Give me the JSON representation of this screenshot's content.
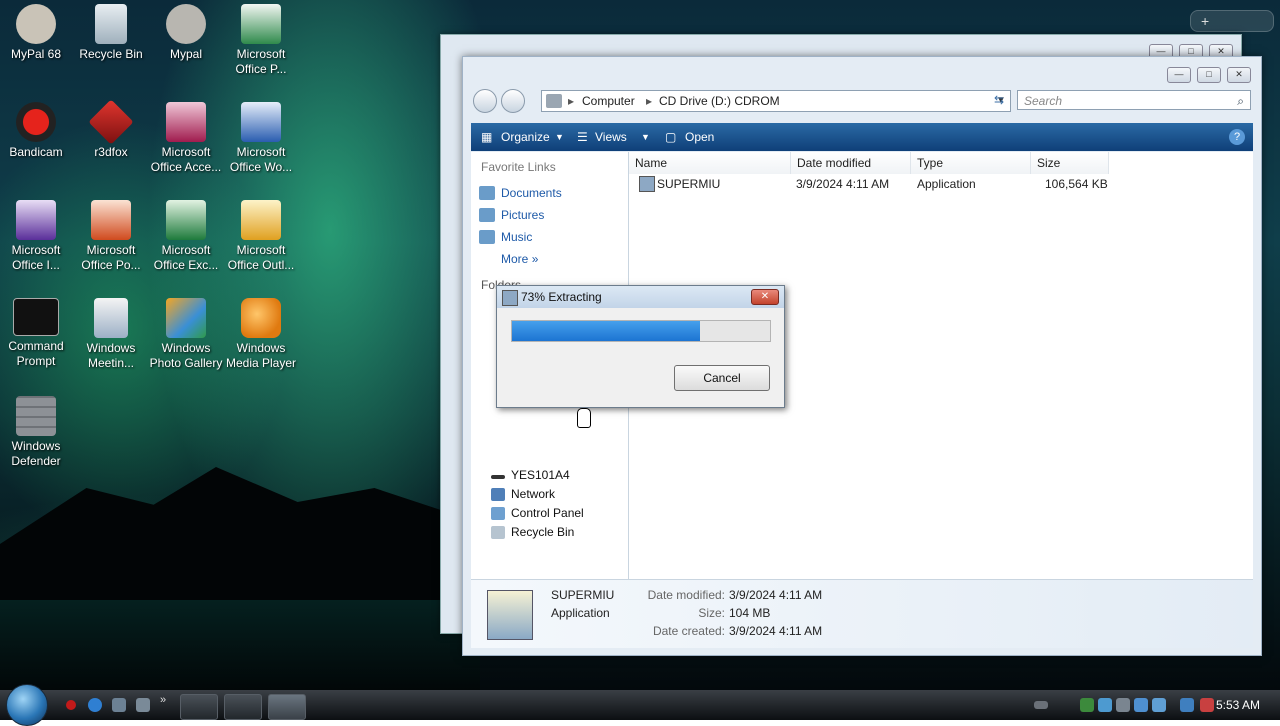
{
  "desktop": {
    "icons": [
      {
        "label": "MyPal 68"
      },
      {
        "label": "Recycle Bin"
      },
      {
        "label": "Mypal"
      },
      {
        "label": "Microsoft Office P..."
      },
      {
        "label": "Bandicam"
      },
      {
        "label": "r3dfox"
      },
      {
        "label": "Microsoft Office Acce..."
      },
      {
        "label": "Microsoft Office Wo..."
      },
      {
        "label": "Microsoft Office I..."
      },
      {
        "label": "Microsoft Office Po..."
      },
      {
        "label": "Microsoft Office Exc..."
      },
      {
        "label": "Microsoft Office Outl..."
      },
      {
        "label": "Command Prompt"
      },
      {
        "label": "Windows Meetin..."
      },
      {
        "label": "Windows Photo Gallery"
      },
      {
        "label": "Windows Media Player"
      },
      {
        "label": "Windows Defender"
      }
    ],
    "top_right_plus": "+"
  },
  "explorer": {
    "path": [
      "Computer",
      "CD Drive (D:) CDROM"
    ],
    "search_placeholder": "Search",
    "toolbar": {
      "organize": "Organize",
      "views": "Views",
      "open": "Open"
    },
    "favorite_links_title": "Favorite Links",
    "favorite_links": [
      "Documents",
      "Pictures",
      "Music"
    ],
    "more_label": "More",
    "folders_label": "Folders",
    "tree": [
      "YES101A4",
      "Network",
      "Control Panel",
      "Recycle Bin"
    ],
    "columns": {
      "name": "Name",
      "date": "Date modified",
      "type": "Type",
      "size": "Size"
    },
    "file": {
      "name": "SUPERMIU",
      "date": "3/9/2024 4:11 AM",
      "type": "Application",
      "size": "106,564 KB"
    },
    "details": {
      "name": "SUPERMIU",
      "type": "Application",
      "date_modified_label": "Date modified:",
      "date_modified": "3/9/2024 4:11 AM",
      "size_label": "Size:",
      "size": "104 MB",
      "date_created_label": "Date created:",
      "date_created": "3/9/2024 4:11 AM"
    }
  },
  "dialog": {
    "title": "73% Extracting",
    "progress": 0.73,
    "cancel": "Cancel",
    "close_glyph": "✕"
  },
  "taskbar": {
    "clock": "5:53 AM"
  },
  "colors": {
    "toolbar": "#1f5590",
    "progress": "#2a86e0",
    "link": "#1e5aa8"
  }
}
